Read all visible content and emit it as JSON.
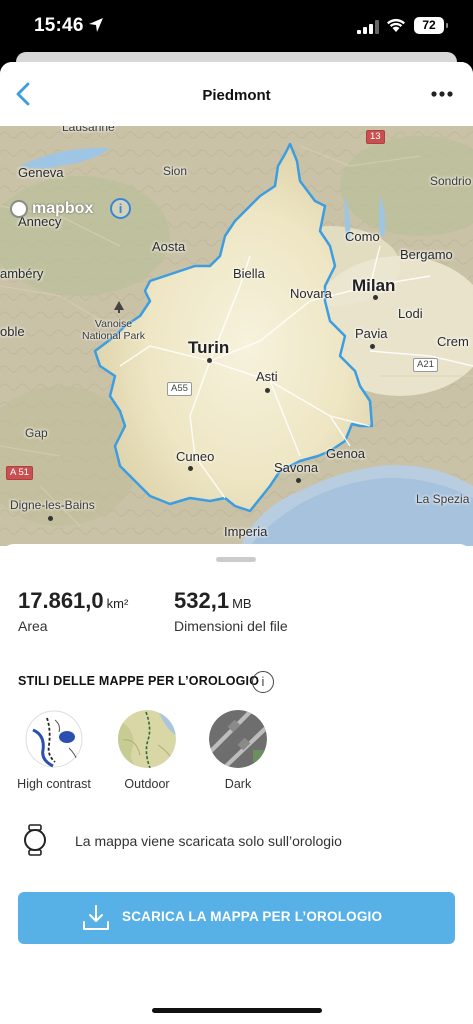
{
  "status_bar": {
    "time": "15:46",
    "battery": "72"
  },
  "nav": {
    "title": "Piedmont",
    "back_icon": "chevron-left-icon",
    "more_icon": "more-horizontal-icon"
  },
  "map": {
    "attribution": "mapbox",
    "region_border_color": "#3c9de0",
    "labels": {
      "lausanne": "Lausanne",
      "geneva": "Geneva",
      "sion": "Sion",
      "annecy": "Annecy",
      "aosta": "Aosta",
      "chambery": "ambéry",
      "biella": "Biella",
      "novara": "Novara",
      "milan": "Milan",
      "como": "Como",
      "bergamo": "Bergamo",
      "sondrio": "Sondrio",
      "lodi": "Lodi",
      "pavia": "Pavia",
      "cremona": "Crem",
      "vanoise": "Vanoise\nNational Park",
      "noble": "oble",
      "turin": "Turin",
      "asti": "Asti",
      "gap": "Gap",
      "cuneo": "Cuneo",
      "savona": "Savona",
      "genoa": "Genoa",
      "digne": "Digne-les-Bains",
      "laspezia": "La Spezia",
      "imperia": "Imperia"
    },
    "road_shields": {
      "r13": "13",
      "a55": "A55",
      "a21": "A21",
      "a51": "A 51"
    }
  },
  "stats": {
    "area_value": "17.861,0",
    "area_unit": "km²",
    "area_label": "Area",
    "size_value": "532,1",
    "size_unit": "MB",
    "size_label": "Dimensioni del file"
  },
  "map_styles": {
    "title": "STILI DELLE MAPPE PER L’OROLOGIO",
    "items": [
      {
        "label": "High contrast"
      },
      {
        "label": "Outdoor"
      },
      {
        "label": "Dark"
      }
    ]
  },
  "watch_note": "La mappa viene scaricata solo sull’orologio",
  "download_button": {
    "label": "SCARICA LA MAPPA PER L’OROLOGIO",
    "color": "#57b0e6"
  }
}
